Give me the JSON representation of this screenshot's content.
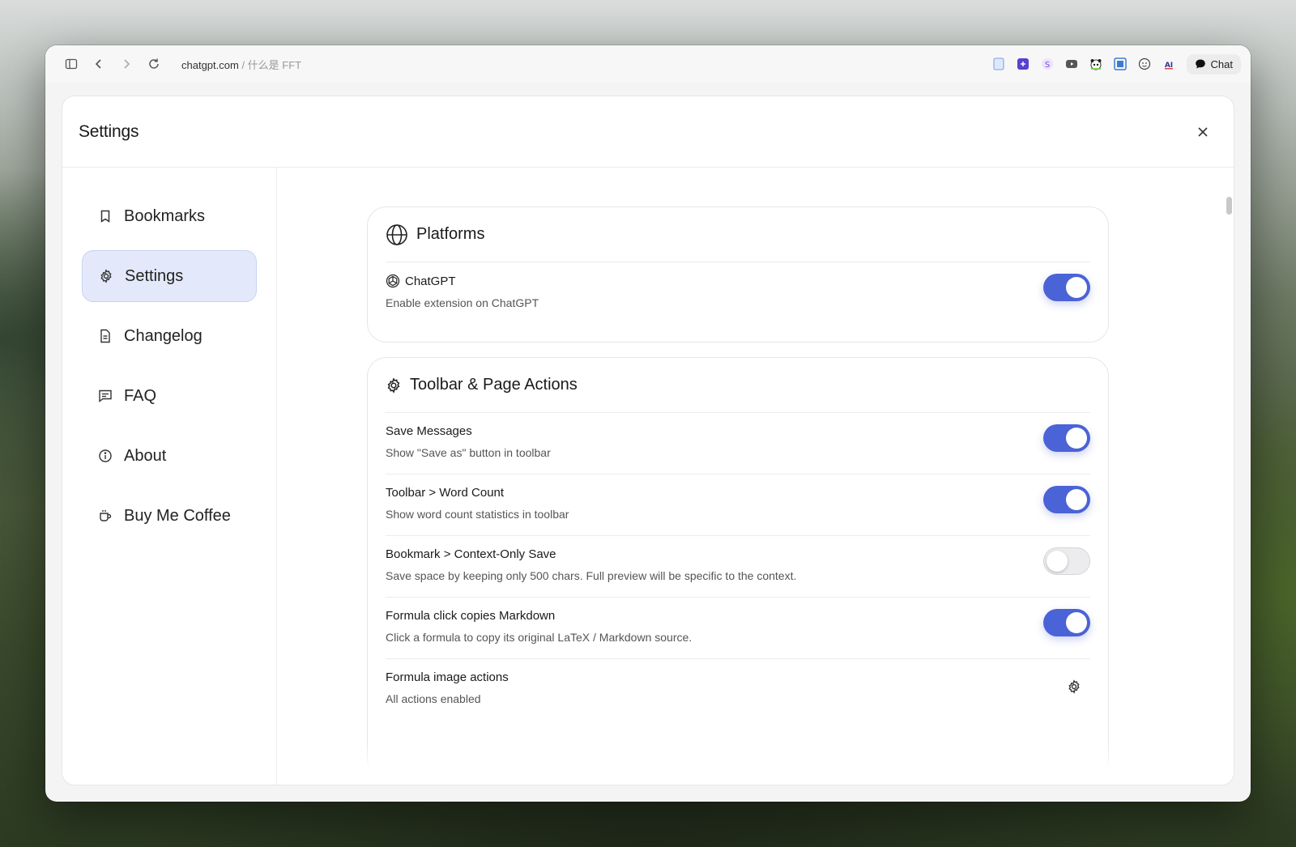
{
  "browser": {
    "url_domain": "chatgpt.com",
    "url_path": " / 什么是 FFT",
    "chat_label": "Chat"
  },
  "dialog": {
    "title": "Settings"
  },
  "sidebar": {
    "items": [
      {
        "label": "Bookmarks",
        "icon": "bookmark-icon",
        "active": false
      },
      {
        "label": "Settings",
        "icon": "gear-icon",
        "active": true
      },
      {
        "label": "Changelog",
        "icon": "document-icon",
        "active": false
      },
      {
        "label": "FAQ",
        "icon": "message-icon",
        "active": false
      },
      {
        "label": "About",
        "icon": "info-icon",
        "active": false
      },
      {
        "label": "Buy Me Coffee",
        "icon": "coffee-icon",
        "active": false
      }
    ]
  },
  "platforms": {
    "title": "Platforms",
    "rows": [
      {
        "title": "ChatGPT",
        "desc": "Enable extension on ChatGPT",
        "enabled": true
      }
    ]
  },
  "toolbar": {
    "title": "Toolbar & Page Actions",
    "rows": [
      {
        "title": "Save Messages",
        "desc": "Show \"Save as\" button in toolbar",
        "enabled": true
      },
      {
        "title": "Toolbar > Word Count",
        "desc": "Show word count statistics in toolbar",
        "enabled": true
      },
      {
        "title": "Bookmark > Context-Only Save",
        "desc": "Save space by keeping only 500 chars. Full preview will be specific to the context.",
        "enabled": false
      },
      {
        "title": "Formula click copies Markdown",
        "desc": "Click a formula to copy its original LaTeX / Markdown source.",
        "enabled": true
      },
      {
        "title": "Formula image actions",
        "desc": "All actions enabled"
      }
    ]
  },
  "colors": {
    "accent": "#4a63d6",
    "active_bg": "#e3e9fb"
  }
}
